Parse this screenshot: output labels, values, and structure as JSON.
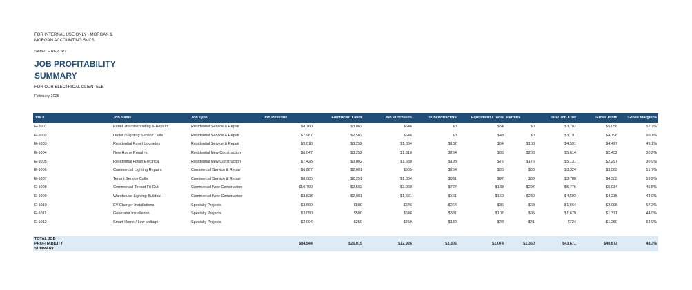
{
  "header": {
    "internal_note": "FOR INTERNAL USE ONLY - MORGAN & MORGAN ACCOUNTING SVCS.",
    "sample_label": "SAMPLE REPORT",
    "title": "JOB PROFITABILITY SUMMARY",
    "subtitle": "FOR OUR ELECTRICAL CLIENTELE",
    "date": "February 2025"
  },
  "table": {
    "columns": [
      "Job #",
      "Job Name",
      "Job Type",
      "Job Revenue",
      "Electrician Labor",
      "Job Purchases",
      "Subcontractors",
      "Equipment / Tools",
      "Permits",
      "Total Job Cost",
      "Gross Profit",
      "Gross Margin %"
    ],
    "rows": [
      [
        "E-1001",
        "Panel Troubleshooting & Repairs",
        "Residential Service & Repair",
        "$8,760",
        "$3,002",
        "$646",
        "$0",
        "$54",
        "$0",
        "$3,702",
        "$5,058",
        "57.7%"
      ],
      [
        "E-1002",
        "Outlet / Lighting Service Calls",
        "Residential Service & Repair",
        "$7,987",
        "$2,502",
        "$646",
        "$0",
        "$43",
        "$0",
        "$3,191",
        "$4,796",
        "60.1%"
      ],
      [
        "E-1003",
        "Residential Panel Upgrades",
        "Residential Service & Repair",
        "$9,018",
        "$3,252",
        "$1,034",
        "$132",
        "$64",
        "$108",
        "$4,591",
        "$4,427",
        "49.1%"
      ],
      [
        "E-1004",
        "New Home Rough-In",
        "Residential New Construction",
        "$8,047",
        "$3,252",
        "$1,810",
        "$264",
        "$86",
        "$203",
        "$5,614",
        "$2,432",
        "30.2%"
      ],
      [
        "E-1005",
        "Residential Finish Electrical",
        "Residential New Construction",
        "$7,428",
        "$3,002",
        "$1,680",
        "$198",
        "$75",
        "$176",
        "$5,131",
        "$2,297",
        "30.9%"
      ],
      [
        "E-1006",
        "Commercial Lighting Repairs",
        "Commercial Service & Repair",
        "$6,887",
        "$2,001",
        "$905",
        "$264",
        "$86",
        "$68",
        "$3,324",
        "$3,563",
        "51.7%"
      ],
      [
        "E-1007",
        "Tenant Service Calls",
        "Commercial Service & Repair",
        "$8,085",
        "$2,251",
        "$1,034",
        "$331",
        "$97",
        "$68",
        "$3,780",
        "$4,305",
        "53.2%"
      ],
      [
        "E-1008",
        "Commercial Tenant Fit-Out",
        "Commercial New Construction",
        "$10,790",
        "$2,502",
        "$2,068",
        "$727",
        "$183",
        "$297",
        "$5,776",
        "$5,014",
        "46.5%"
      ],
      [
        "E-1009",
        "Warehouse Lighting Buildout",
        "Commercial New Construction",
        "$8,828",
        "$2,001",
        "$1,551",
        "$661",
        "$150",
        "$230",
        "$4,593",
        "$4,235",
        "48.0%"
      ],
      [
        "E-1010",
        "EV Charger Installations",
        "Specialty Projects",
        "$3,660",
        "$500",
        "$646",
        "$264",
        "$86",
        "$68",
        "$1,564",
        "$2,095",
        "57.3%"
      ],
      [
        "E-1011",
        "Generator Installation",
        "Specialty Projects",
        "$3,050",
        "$500",
        "$646",
        "$331",
        "$107",
        "$95",
        "$1,679",
        "$1,371",
        "44.9%"
      ],
      [
        "E-1012",
        "Smart Home / Low Voltage",
        "Specialty Projects",
        "$2,004",
        "$250",
        "$259",
        "$132",
        "$43",
        "$41",
        "$724",
        "$1,280",
        "63.9%"
      ]
    ],
    "total": {
      "label": "TOTAL JOB PROFITABILITY SUMMARY",
      "values": [
        "$84,544",
        "$25,015",
        "$12,926",
        "$3,306",
        "$1,074",
        "$1,350",
        "$43,671",
        "$40,873",
        "48.3%"
      ]
    }
  },
  "colors": {
    "header_bg": "#1f4e79",
    "title": "#1f4e79",
    "total_bg": "#ddebf7"
  }
}
